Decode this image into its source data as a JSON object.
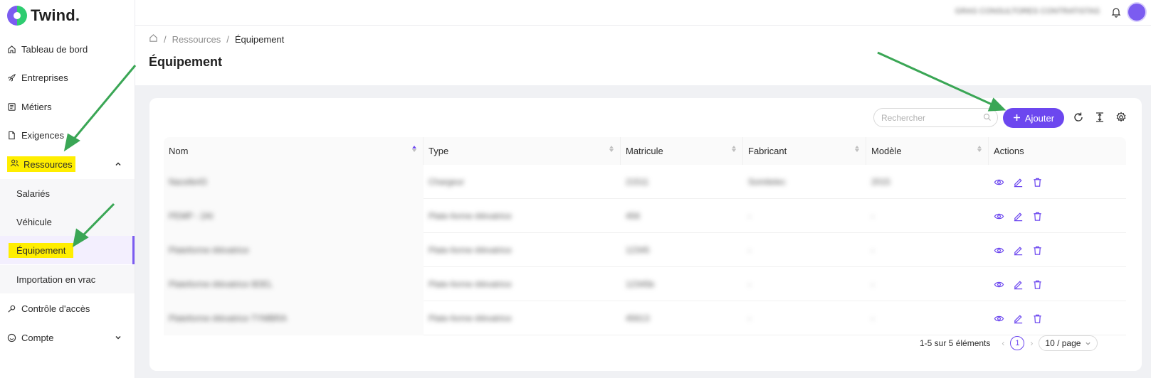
{
  "app": {
    "name": "Twind."
  },
  "sidebar": {
    "items": [
      {
        "label": "Tableau de bord",
        "icon": "home-icon"
      },
      {
        "label": "Entreprises",
        "icon": "rocket-icon"
      },
      {
        "label": "Métiers",
        "icon": "list-icon"
      },
      {
        "label": "Exigences",
        "icon": "document-icon"
      },
      {
        "label": "Ressources",
        "icon": "people-icon",
        "expanded": true
      },
      {
        "label": "Contrôle d'accès",
        "icon": "key-icon"
      },
      {
        "label": "Compte",
        "icon": "user-circle-icon"
      }
    ],
    "sub_items": [
      "Salariés",
      "Véhicule",
      "Équipement",
      "Importation en vrac"
    ]
  },
  "topbar": {
    "user": "GRAS CONSULTORES CONTRATISTAS"
  },
  "breadcrumb": {
    "parent": "Ressources",
    "current": "Équipement",
    "sep": "/"
  },
  "page": {
    "title": "Équipement"
  },
  "toolbar": {
    "search_placeholder": "Rechercher",
    "add_label": "Ajouter"
  },
  "table": {
    "columns": [
      "Nom",
      "Type",
      "Matricule",
      "Fabricant",
      "Modèle",
      "Actions"
    ],
    "rows": [
      [
        "Nacelle43",
        "Chargeur",
        "21511",
        "Somitelec",
        "2015"
      ],
      [
        "PEMP - 2AI",
        "Plate-forme élévatrice",
        "456",
        "-",
        "-"
      ],
      [
        "Plateforme élévatrice",
        "Plate-forme élévatrice",
        "12345",
        "-",
        "-"
      ],
      [
        "Plateforme élévatrice 8DEL",
        "Plate-forme élévatrice",
        "12345b",
        "-",
        "-"
      ],
      [
        "Plateforme élévatrice TYMBRA",
        "Plate-forme élévatrice",
        "45613",
        "-",
        "-"
      ]
    ]
  },
  "pagination": {
    "summary": "1-5 sur 5 éléments",
    "page": "1",
    "page_size": "10 / page"
  },
  "colors": {
    "accent": "#6c47ef",
    "highlight": "#ffee00",
    "arrow": "#3aa655"
  }
}
